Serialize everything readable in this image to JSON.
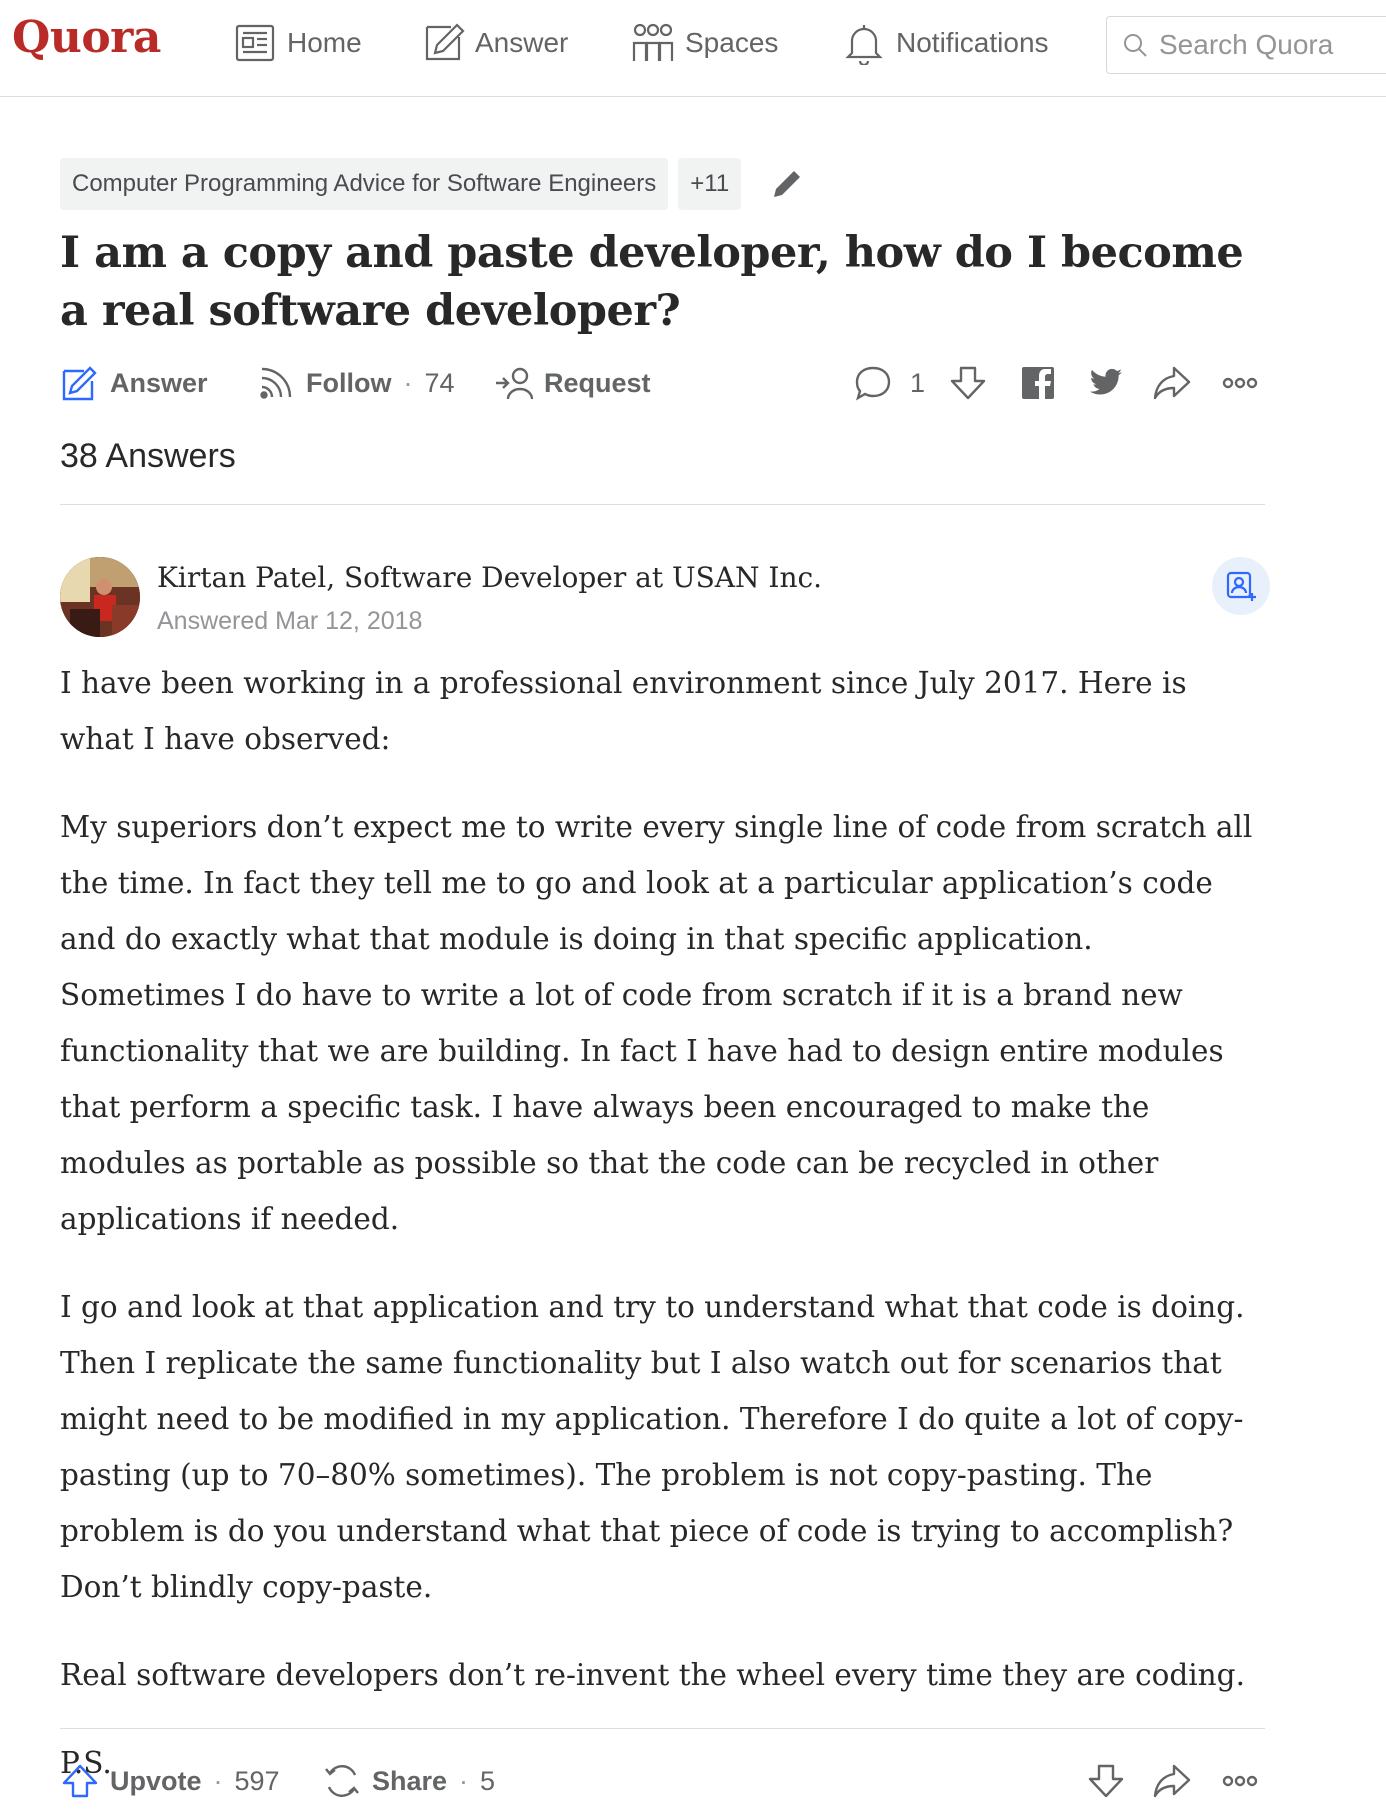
{
  "app": {
    "logo": "Quora"
  },
  "nav": {
    "home": "Home",
    "answer": "Answer",
    "spaces": "Spaces",
    "notifications": "Notifications",
    "search_placeholder": "Search Quora"
  },
  "question": {
    "topics": [
      "Computer Programming Advice for Software Engineers"
    ],
    "more_topics": "+11",
    "title": "I am a copy and paste developer, how do I become a real software developer?",
    "actions": {
      "answer_label": "Answer",
      "follow_label": "Follow",
      "follow_count": "74",
      "request_label": "Request",
      "comment_count": "1"
    },
    "answers_count": "38 Answers"
  },
  "answer": {
    "author_name": "Kirtan Patel, Software Developer at USAN Inc.",
    "date": "Answered Mar 12, 2018",
    "paragraphs": [
      "I have been working in a professional environment since July 2017. Here is what I have observed:",
      "My superiors don’t expect me to write every single line of code from scratch all the time. In fact they tell me to go and look at a particular application’s code and do exactly what that module is doing in that specific application. Sometimes I do have to write a lot of code from scratch if it is a brand new functionality that we are building. In fact I have had to design entire modules that perform a specific task. I have always been encouraged to make the modules as portable as possible so that the code can be recycled in other applications if needed.",
      "I go and look at that application and try to understand what that code is doing. Then I replicate the same functionality but I also watch out for scenarios that might need to be modified in my application. Therefore I do quite a lot of copy-pasting (up to 70–80% sometimes). The problem is not copy-pasting. The problem is do you understand what that piece of code is trying to accomplish? Don’t blindly copy-paste.",
      "Real software developers don’t re-invent the wheel every time they are coding.",
      "P.S."
    ],
    "upvote_label": "Upvote",
    "upvote_count": "597",
    "share_label": "Share",
    "share_count": "5"
  },
  "colors": {
    "brand": "#b92b27",
    "icon": "#636466",
    "text": "#282829",
    "muted": "#939598",
    "link_blue": "#2e69ff"
  }
}
